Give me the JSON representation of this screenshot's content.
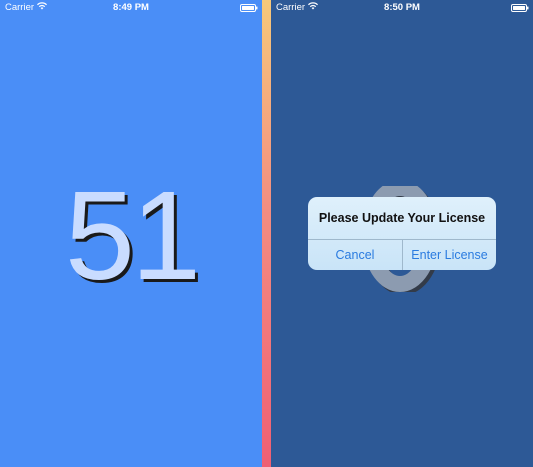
{
  "left_screen": {
    "status_bar": {
      "carrier": "Carrier",
      "time": "8:49 PM",
      "wifi_icon": "wifi-icon",
      "battery_icon": "battery-icon"
    },
    "counter_value": "51",
    "background_color": "#4a8ef7"
  },
  "right_screen": {
    "status_bar": {
      "carrier": "Carrier",
      "time": "8:50 PM",
      "wifi_icon": "wifi-icon",
      "battery_icon": "battery-icon"
    },
    "background_color": "#2d5996",
    "alert": {
      "title": "Please Update Your License",
      "cancel_label": "Cancel",
      "enter_license_label": "Enter License",
      "accent_color": "#2a7be0"
    }
  }
}
